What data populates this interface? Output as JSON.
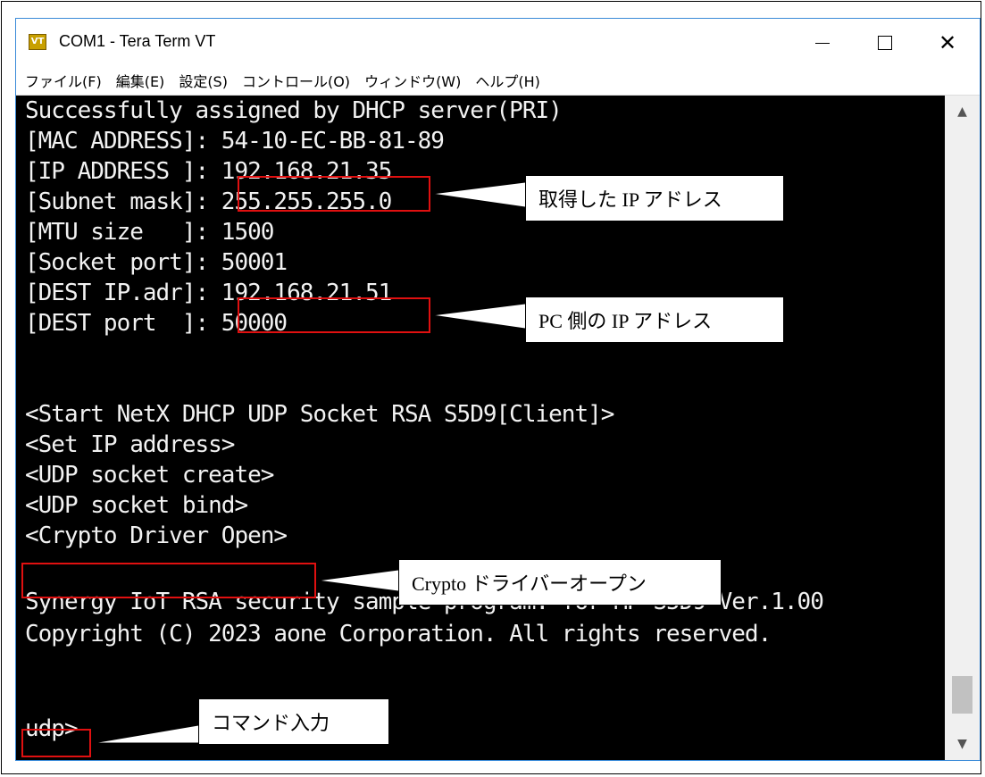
{
  "window": {
    "title": "COM1 - Tera Term VT",
    "icon_text": "VT",
    "minimize_icon": "minimize-icon",
    "maximize_icon": "maximize-icon",
    "close_icon": "close-icon"
  },
  "menu": [
    "ファイル(F)",
    "編集(E)",
    "設定(S)",
    "コントロール(O)",
    "ウィンドウ(W)",
    "ヘルプ(H)"
  ],
  "terminal": {
    "lines": [
      "Successfully assigned by DHCP server(PRI)",
      "[MAC ADDRESS]: 54-10-EC-BB-81-89",
      "[IP ADDRESS ]: 192.168.21.35",
      "[Subnet mask]: 255.255.255.0",
      "[MTU size   ]: 1500",
      "[Socket port]: 50001",
      "[DEST IP.adr]: 192.168.21.51",
      "[DEST port  ]: 50000",
      "",
      "",
      "<Start NetX DHCP UDP Socket RSA S5D9[Client]>",
      "<Set IP address>",
      "<UDP socket create>",
      "<UDP socket bind>",
      "<Crypto Driver Open>",
      "",
      "Synergy IoT RSA security sample program. for MP-S5D9 Ver.1.00",
      "Copyright (C) 2023 aone Corporation. All rights reserved.",
      "",
      "udp>"
    ],
    "text_color": "#f2f2f2",
    "background": "#000000"
  },
  "annotations": {
    "ip_address": "取得した IP アドレス",
    "pc_ip": "PC 側の IP アドレス",
    "crypto_open": "Crypto ドライバーオープン",
    "command_input": "コマンド入力",
    "highlight_color": "#e01010"
  },
  "scrollbar": {
    "up_icon": "▲",
    "down_icon": "▼"
  }
}
